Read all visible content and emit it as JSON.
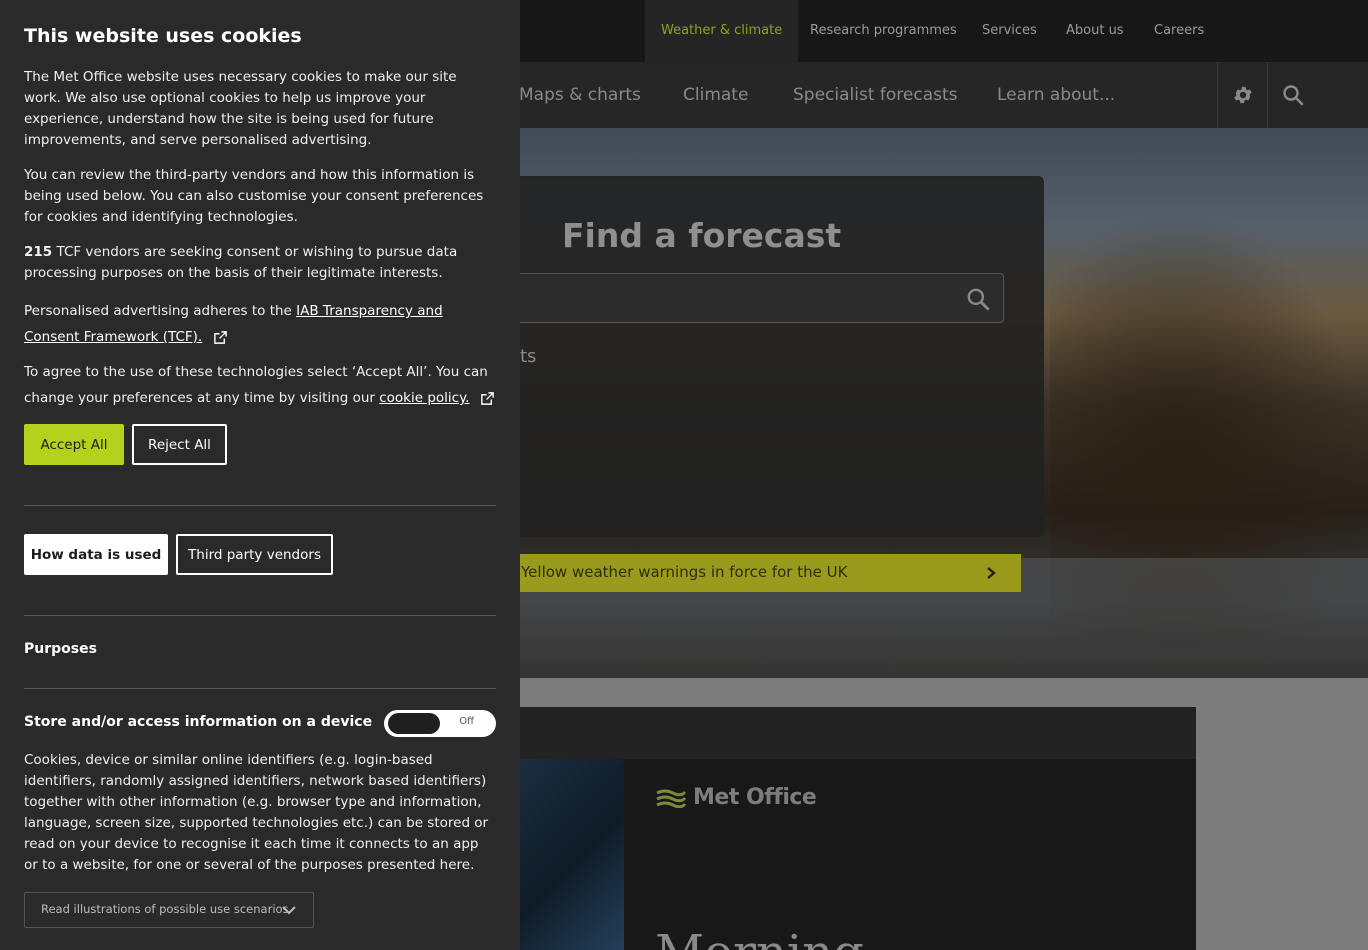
{
  "top_nav": {
    "items": [
      "Weather & climate",
      "Research programmes",
      "Services",
      "About us",
      "Careers"
    ],
    "active_index": 0
  },
  "main_nav": {
    "items": [
      "Maps & charts",
      "Climate",
      "Specialist forecasts",
      "Learn about..."
    ]
  },
  "hero": {
    "title": "Find a forecast",
    "search_value": "",
    "fragment_text": "ts",
    "warning": "Yellow weather warnings in force for the UK"
  },
  "promo": {
    "logo_text": "Met Office",
    "headline": "Morning"
  },
  "cookie": {
    "title": "This website uses cookies",
    "intro": "The Met Office website uses necessary cookies to make our site work. We also use optional cookies to help us improve your experience, understand how the site is being used for future improvements, and serve personalised advertising.",
    "review": "You can review the third-party vendors and how this information is being used below. You can also customise your consent preferences for cookies and identifying technologies.",
    "vendor_count": "215",
    "vendor_text": "TCF vendors are seeking consent or wishing to pursue data processing purposes on the basis of their legitimate interests.",
    "iab_prefix": "Personalised advertising adheres to the",
    "iab_link": "IAB Transparency and Consent Framework (TCF).",
    "agree_prefix": "To agree to the use of these technologies select ‘Accept All’. You can change your preferences at any time by visiting our",
    "policy_link": "cookie policy.",
    "accept_label": "Accept All",
    "reject_label": "Reject All",
    "how_label": "How data is used",
    "vendors_label": "Third party vendors",
    "purposes_heading": "Purposes",
    "store_heading": "Store and/or access information on a device",
    "toggle_label": "Off",
    "store_text": "Cookies, device or similar online identifiers (e.g. login-based identifiers, randomly assigned identifiers, network based identifiers) together with other information (e.g. browser type and information, language, screen size, supported technologies etc.) can be stored or read on your device to recognise it each time it connects to an app or to a website, for one or several of the purposes presented here.",
    "scenarios_label": "Read illustrations of possible use scenarios"
  },
  "colors": {
    "accent_green": "#b4d21c",
    "panel_bg": "#2a2a2a",
    "warning_yellow": "#9a9a1c"
  }
}
